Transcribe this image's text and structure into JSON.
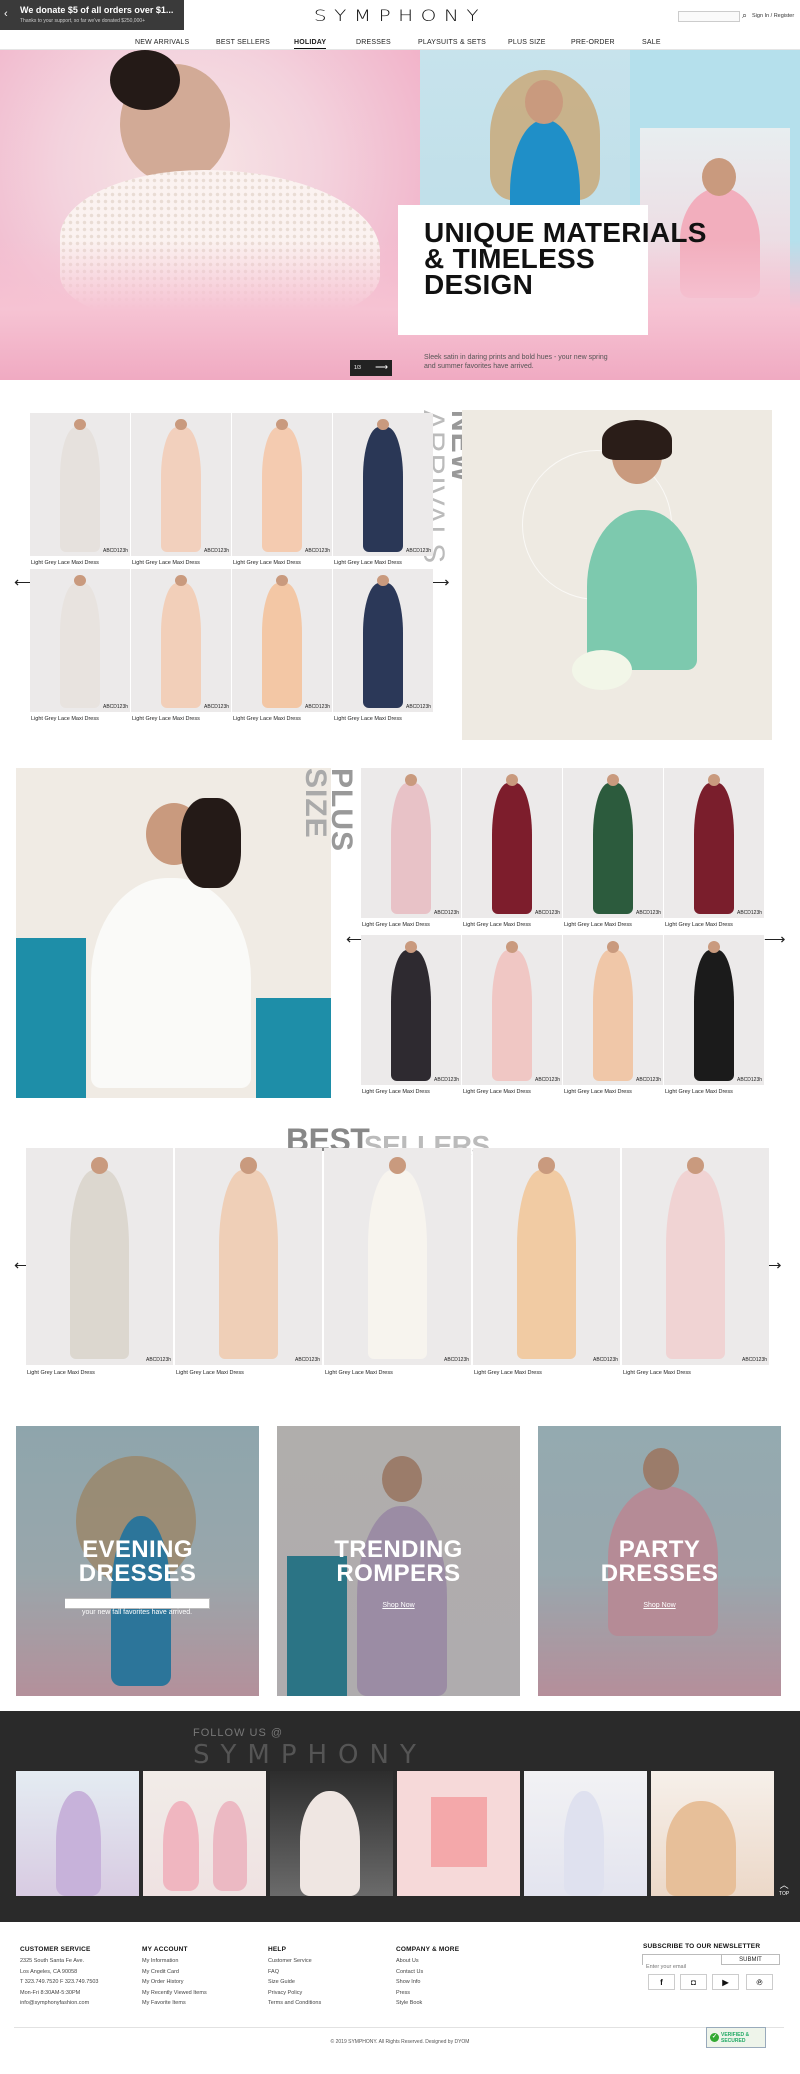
{
  "promo": {
    "headline": "We donate $5 of all orders over $1...",
    "subline": "Thanks to your support, so far we've donated $250,000+"
  },
  "header": {
    "brand": "SYMPHONY",
    "search_placeholder": "",
    "account": "Sign In / Register"
  },
  "nav": {
    "items": [
      "NEW ARRIVALS",
      "BEST SELLERS",
      "HOLIDAY",
      "DRESSES",
      "PLAYSUITS & SETS",
      "PLUS SIZE",
      "PRE-ORDER",
      "SALE"
    ],
    "active": "HOLIDAY"
  },
  "hero": {
    "title_line1": "UNIQUE MATERIALS",
    "title_line2": "& TIMELESS",
    "title_line3": "DESIGN",
    "subtitle_line1": "Sleek satin in daring prints and bold hues - your new spring",
    "subtitle_line2": "and summer favorites have arrived.",
    "pager": "1/3"
  },
  "new_arrivals": {
    "heading_1": "NEW",
    "heading_2": "ARRIVALS",
    "products": [
      {
        "name": "Light Grey Lace Maxi Dress",
        "code": "ABCD123h"
      },
      {
        "name": "Light Grey Lace Maxi Dress",
        "code": "ABCD123h"
      },
      {
        "name": "Light Grey Lace Maxi Dress",
        "code": "ABCD123h"
      },
      {
        "name": "Light Grey Lace Maxi Dress",
        "code": "ABCD123h"
      },
      {
        "name": "Light Grey Lace Maxi Dress",
        "code": "ABCD123h"
      },
      {
        "name": "Light Grey Lace Maxi Dress",
        "code": "ABCD123h"
      },
      {
        "name": "Light Grey Lace Maxi Dress",
        "code": "ABCD123h"
      },
      {
        "name": "Light Grey Lace Maxi Dress",
        "code": "ABCD123h"
      }
    ]
  },
  "plus_size": {
    "heading_1": "PLUS",
    "heading_2": "SIZE",
    "products": [
      {
        "name": "Light Grey Lace Maxi Dress",
        "code": "ABCD123h"
      },
      {
        "name": "Light Grey Lace Maxi Dress",
        "code": "ABCD123h"
      },
      {
        "name": "Light Grey Lace Maxi Dress",
        "code": "ABCD123h"
      },
      {
        "name": "Light Grey Lace Maxi Dress",
        "code": "ABCD123h"
      },
      {
        "name": "Light Grey Lace Maxi Dress",
        "code": "ABCD123h"
      },
      {
        "name": "Light Grey Lace Maxi Dress",
        "code": "ABCD123h"
      },
      {
        "name": "Light Grey Lace Maxi Dress",
        "code": "ABCD123h"
      },
      {
        "name": "Light Grey Lace Maxi Dress",
        "code": "ABCD123h"
      }
    ]
  },
  "best_sellers": {
    "heading_1": "BEST",
    "heading_2": "SELLERS",
    "products": [
      {
        "name": "Light Grey Lace Maxi Dress",
        "code": "ABCD123h"
      },
      {
        "name": "Light Grey Lace Maxi Dress",
        "code": "ABCD123h"
      },
      {
        "name": "Light Grey Lace Maxi Dress",
        "code": "ABCD123h"
      },
      {
        "name": "Light Grey Lace Maxi Dress",
        "code": "ABCD123h"
      },
      {
        "name": "Light Grey Lace Maxi Dress",
        "code": "ABCD123h"
      }
    ]
  },
  "categories": [
    {
      "line1": "EVENING",
      "line2": "DRESSES",
      "text": "Sleek satin in daring prints and bold hues - your new fall favorites have arrived."
    },
    {
      "line1": "TRENDING",
      "line2": "ROMPERS",
      "link": "Shop Now"
    },
    {
      "line1": "PARTY",
      "line2": "DRESSES",
      "link": "Shop Now"
    }
  ],
  "instagram": {
    "label": "FOLLOW US @",
    "brand": "SYMPHONY",
    "back_to_top": "TOP"
  },
  "footer": {
    "customer_service": {
      "heading": "CUSTOMER SERVICE",
      "lines": [
        "2325 South Santa Fe Ave.",
        "Los Angeles, CA 90058",
        "T 323.749.7520 F 323.749.7503",
        "Mon-Fri 8:30AM-5:30PM",
        "info@symphonyfashion.com"
      ]
    },
    "my_account": {
      "heading": "MY ACCOUNT",
      "links": [
        "My Information",
        "My Credit Card",
        "My Order History",
        "My Recently Viewed Items",
        "My Favorite Items"
      ]
    },
    "help": {
      "heading": "HELP",
      "links": [
        "Customer Service",
        "FAQ",
        "Size Guide",
        "Privacy Policy",
        "Terms and Conditions"
      ]
    },
    "company": {
      "heading": "COMPANY & MORE",
      "links": [
        "About Us",
        "Contact Us",
        "Show Info",
        "Press",
        "Style Book"
      ]
    },
    "newsletter": {
      "heading": "SUBSCRIBE TO OUR NEWSLETTER",
      "placeholder": "Enter your email",
      "button": "SUBMIT",
      "social": [
        "facebook-icon",
        "instagram-icon",
        "youtube-icon",
        "pinterest-icon"
      ]
    },
    "copyright": "© 2019 SYMPHONY. All Rights Reserved. Designed by DYOM",
    "secure_badge": "VERIFIED & SECURED"
  }
}
